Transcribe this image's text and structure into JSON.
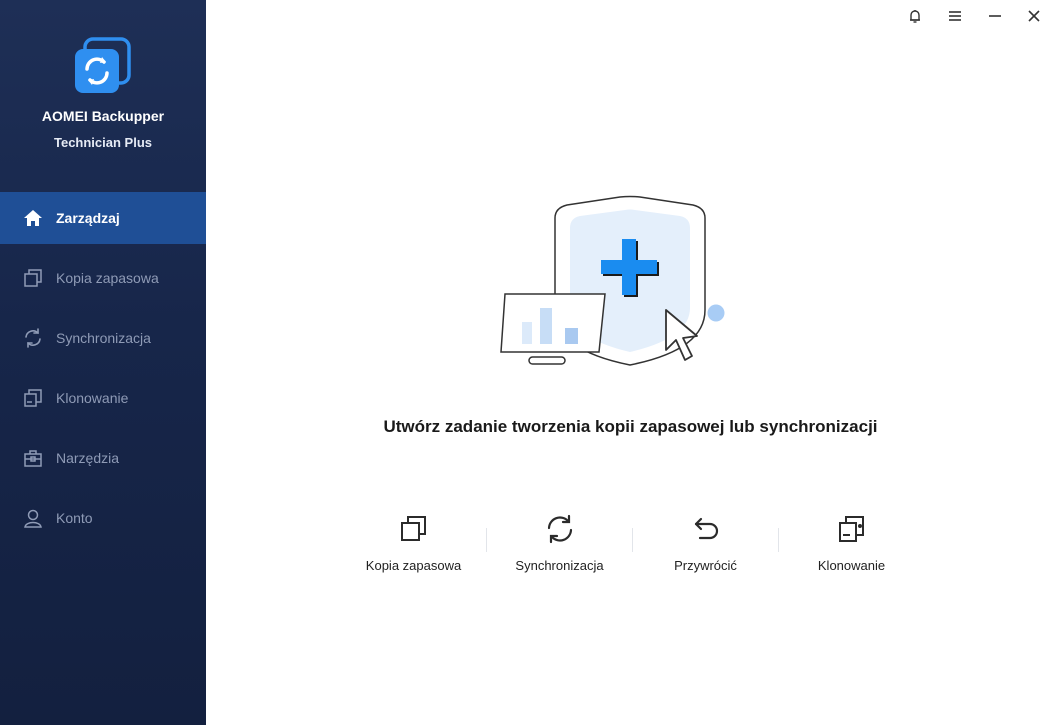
{
  "app": {
    "name": "AOMEI Backupper",
    "edition": "Technician Plus"
  },
  "sidebar": {
    "items": [
      {
        "label": "Zarządzaj",
        "icon": "home-icon",
        "active": true
      },
      {
        "label": "Kopia zapasowa",
        "icon": "backup-icon",
        "active": false
      },
      {
        "label": "Synchronizacja",
        "icon": "sync-icon",
        "active": false
      },
      {
        "label": "Klonowanie",
        "icon": "clone-icon",
        "active": false
      },
      {
        "label": "Narzędzia",
        "icon": "toolbox-icon",
        "active": false
      },
      {
        "label": "Konto",
        "icon": "user-icon",
        "active": false
      }
    ]
  },
  "titlebar": {
    "buttons": [
      "bell-icon",
      "menu-icon",
      "minimize-icon",
      "close-icon"
    ]
  },
  "main": {
    "headline": "Utwórz zadanie tworzenia kopii zapasowej lub synchronizacji",
    "actions": [
      {
        "label": "Kopia zapasowa",
        "icon": "backup-icon"
      },
      {
        "label": "Synchronizacja",
        "icon": "sync-icon"
      },
      {
        "label": "Przywrócić",
        "icon": "restore-icon"
      },
      {
        "label": "Klonowanie",
        "icon": "clone-icon"
      }
    ]
  },
  "colors": {
    "sidebar_bg": "#1a2a50",
    "active_item": "#1f4f96",
    "accent": "#1a8cf0"
  }
}
